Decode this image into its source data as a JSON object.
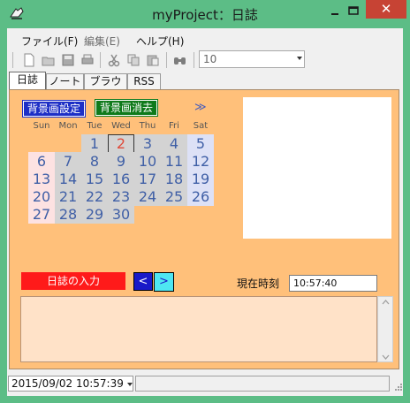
{
  "window": {
    "title": "myProject：日誌",
    "close_glyph": "✕",
    "frame_color": "#5cbd86"
  },
  "menubar": {
    "items": [
      {
        "label": "ファイル(F)",
        "enabled": true
      },
      {
        "label": "編集(E)",
        "enabled": false
      },
      {
        "label": "ヘルプ(H)",
        "enabled": true
      }
    ]
  },
  "toolbar": {
    "icons": [
      "new-file-icon",
      "open-folder-icon",
      "save-icon",
      "print-icon",
      "cut-icon",
      "copy-icon",
      "paste-icon",
      "find-icon"
    ],
    "zoom_value": "10"
  },
  "tabs": [
    {
      "label": "日誌",
      "active": true
    },
    {
      "label": "ノート",
      "active": false
    },
    {
      "label": "ブラウザ",
      "active": false
    },
    {
      "label": "RSS",
      "active": false
    }
  ],
  "diary": {
    "bg_set_label": "背景画設定",
    "bg_clear_label": "背景画消去",
    "next_month_label": "≫",
    "weekdays": [
      "Sun",
      "Mon",
      "Tue",
      "Wed",
      "Thu",
      "Fri",
      "Sat"
    ],
    "today": "2",
    "weeks": [
      [
        "",
        "",
        "1",
        "2",
        "3",
        "4",
        "5"
      ],
      [
        "6",
        "7",
        "8",
        "9",
        "10",
        "11",
        "12"
      ],
      [
        "13",
        "14",
        "15",
        "16",
        "17",
        "18",
        "19"
      ],
      [
        "20",
        "21",
        "22",
        "23",
        "24",
        "25",
        "26"
      ],
      [
        "27",
        "28",
        "29",
        "30",
        "",
        "",
        ""
      ]
    ],
    "diary_input_label": "日誌の入力",
    "prev_label": "<",
    "next_label": ">",
    "clock_label": "現在時刻",
    "clock_value": "10:57:40",
    "pane_color": "#ffc07a"
  },
  "statusbar": {
    "datetime": "2015/09/02 10:57:39"
  }
}
